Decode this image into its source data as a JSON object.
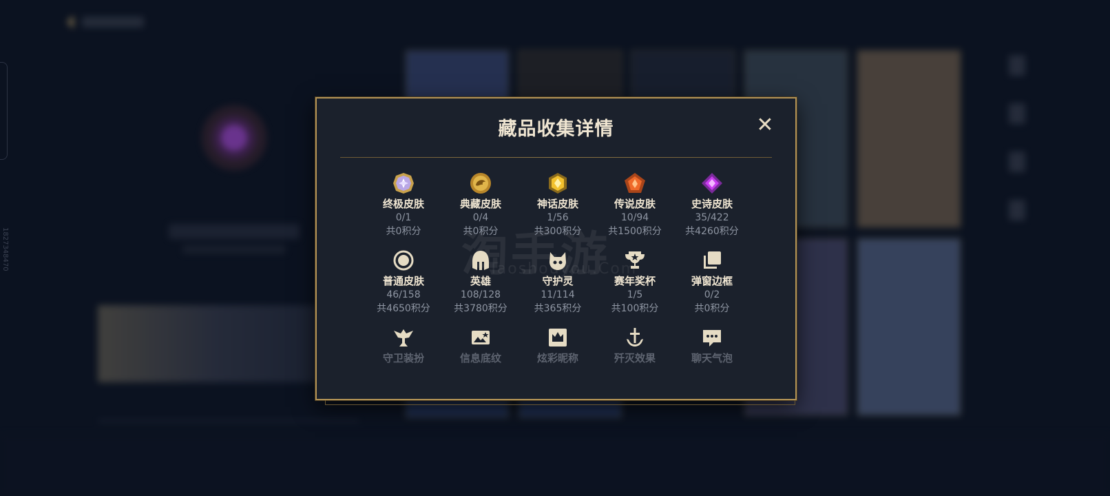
{
  "modal": {
    "title": "藏品收集详情",
    "close_symbol": "✕",
    "categories": [
      {
        "label": "终极皮肤",
        "count": "0/1",
        "points": "共0积分",
        "icon": "ultimate-gem-icon"
      },
      {
        "label": "典藏皮肤",
        "count": "0/4",
        "points": "共0积分",
        "icon": "dragon-coin-icon"
      },
      {
        "label": "神话皮肤",
        "count": "1/56",
        "points": "共300积分",
        "icon": "mythic-gem-icon"
      },
      {
        "label": "传说皮肤",
        "count": "10/94",
        "points": "共1500积分",
        "icon": "legendary-gem-icon"
      },
      {
        "label": "史诗皮肤",
        "count": "35/422",
        "points": "共4260积分",
        "icon": "epic-gem-icon"
      },
      {
        "label": "普通皮肤",
        "count": "46/158",
        "points": "共4650积分",
        "icon": "ring-icon"
      },
      {
        "label": "英雄",
        "count": "108/128",
        "points": "共3780积分",
        "icon": "helmet-icon"
      },
      {
        "label": "守护灵",
        "count": "11/114",
        "points": "共365积分",
        "icon": "guardian-pet-icon"
      },
      {
        "label": "赛年奖杯",
        "count": "1/5",
        "points": "共100积分",
        "icon": "trophy-icon"
      },
      {
        "label": "弹窗边框",
        "count": "0/2",
        "points": "共0积分",
        "icon": "frame-stack-icon"
      },
      {
        "label": "守卫装扮",
        "icon": "ward-icon"
      },
      {
        "label": "信息底纹",
        "icon": "banner-icon"
      },
      {
        "label": "炫彩昵称",
        "icon": "crown-card-icon"
      },
      {
        "label": "歼灭效果",
        "icon": "sword-icon"
      },
      {
        "label": "聊天气泡",
        "icon": "chat-bubble-icon"
      }
    ]
  },
  "watermark": {
    "main": "淘手游",
    "sub": "Taoshouyou.Com"
  },
  "side_id": "1827348470",
  "colors": {
    "gold": "#c8aa6e",
    "panel": "#1b212c",
    "text": "#f0e6d2",
    "muted": "#8f96a3"
  }
}
